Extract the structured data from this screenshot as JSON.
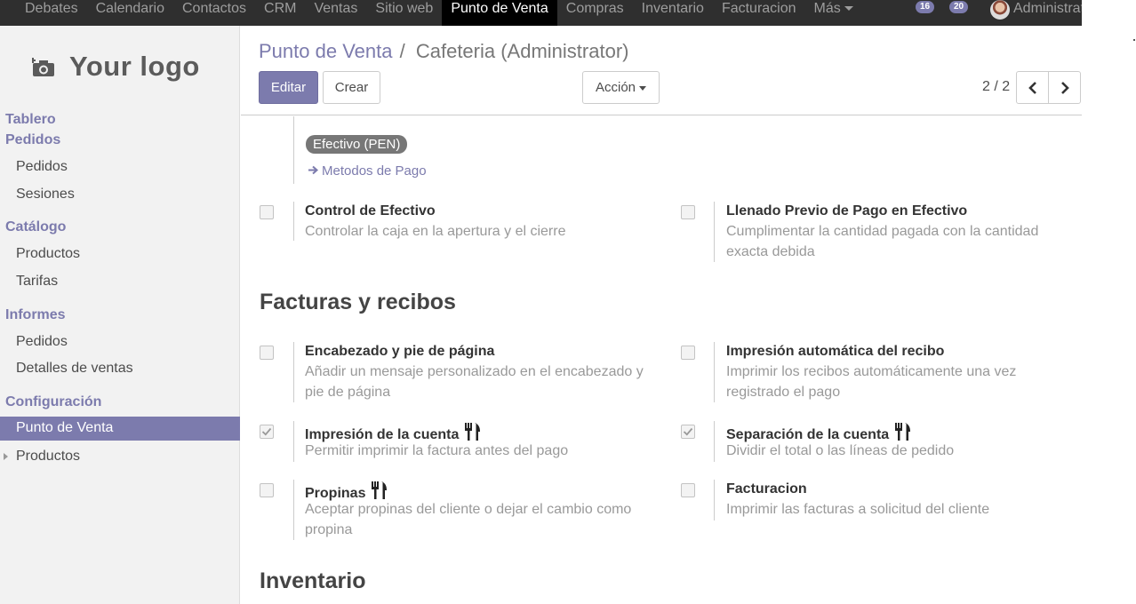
{
  "topbar": {
    "menu": [
      "Debates",
      "Calendario",
      "Contactos",
      "CRM",
      "Ventas",
      "Sitio web",
      "Punto de Venta",
      "Compras",
      "Inventario",
      "Facturacion",
      "Más"
    ],
    "active_index": 6,
    "notifications_count": "16",
    "messages_count": "20",
    "user_name": "Administrator"
  },
  "sidebar": {
    "logo_text": "Your logo",
    "tablero": "Tablero",
    "pedidos_heading": "Pedidos",
    "pedidos_items": [
      "Pedidos",
      "Sesiones"
    ],
    "catalogo_heading": "Catálogo",
    "catalogo_items": [
      "Productos",
      "Tarifas"
    ],
    "informes_heading": "Informes",
    "informes_items": [
      "Pedidos",
      "Detalles de ventas"
    ],
    "config_heading": "Configuración",
    "config_items": [
      "Punto de Venta",
      "Productos"
    ]
  },
  "breadcrumb": {
    "parent": "Punto de Venta",
    "separator": "/",
    "current": "Cafeteria (Administrator)"
  },
  "buttons": {
    "edit": "Editar",
    "create": "Crear",
    "action": "Acción"
  },
  "pager": {
    "value": "2 / 2"
  },
  "payment": {
    "tag": "Efectivo (PEN)",
    "link": "Metodos de Pago"
  },
  "options_top": [
    {
      "title": "Control de Efectivo",
      "desc": "Controlar la caja en la apertura y el cierre",
      "checked": false
    },
    {
      "title": "Llenado Previo de Pago en Efectivo",
      "desc": "Cumplimentar la cantidad pagada con la cantidad exacta debida",
      "checked": false
    }
  ],
  "section_facturas": "Facturas y recibos",
  "options_facturas": [
    {
      "title": "Encabezado y pie de página",
      "desc": "Añadir un mensaje personalizado en el encabezado y pie de página",
      "checked": false
    },
    {
      "title": "Impresión automática del recibo",
      "desc": "Imprimir los recibos automáticamente una vez registrado el pago",
      "checked": false
    },
    {
      "title": "Impresión de la cuenta",
      "desc": "Permitir imprimir la factura antes del pago",
      "checked": true
    },
    {
      "title": "Separación de la cuenta",
      "desc": "Dividir el total o las líneas de pedido",
      "checked": true
    },
    {
      "title": "Propinas",
      "desc": "Aceptar propinas del cliente o dejar el cambio como propina",
      "checked": false
    },
    {
      "title": "Facturacion",
      "desc": "Imprimir las facturas a solicitud del cliente",
      "checked": false
    }
  ],
  "section_inventario": "Inventario",
  "colors": {
    "brand": "#7c7bad",
    "topbar": "#2f2f2f",
    "sidebar": "#f2f2f2"
  }
}
